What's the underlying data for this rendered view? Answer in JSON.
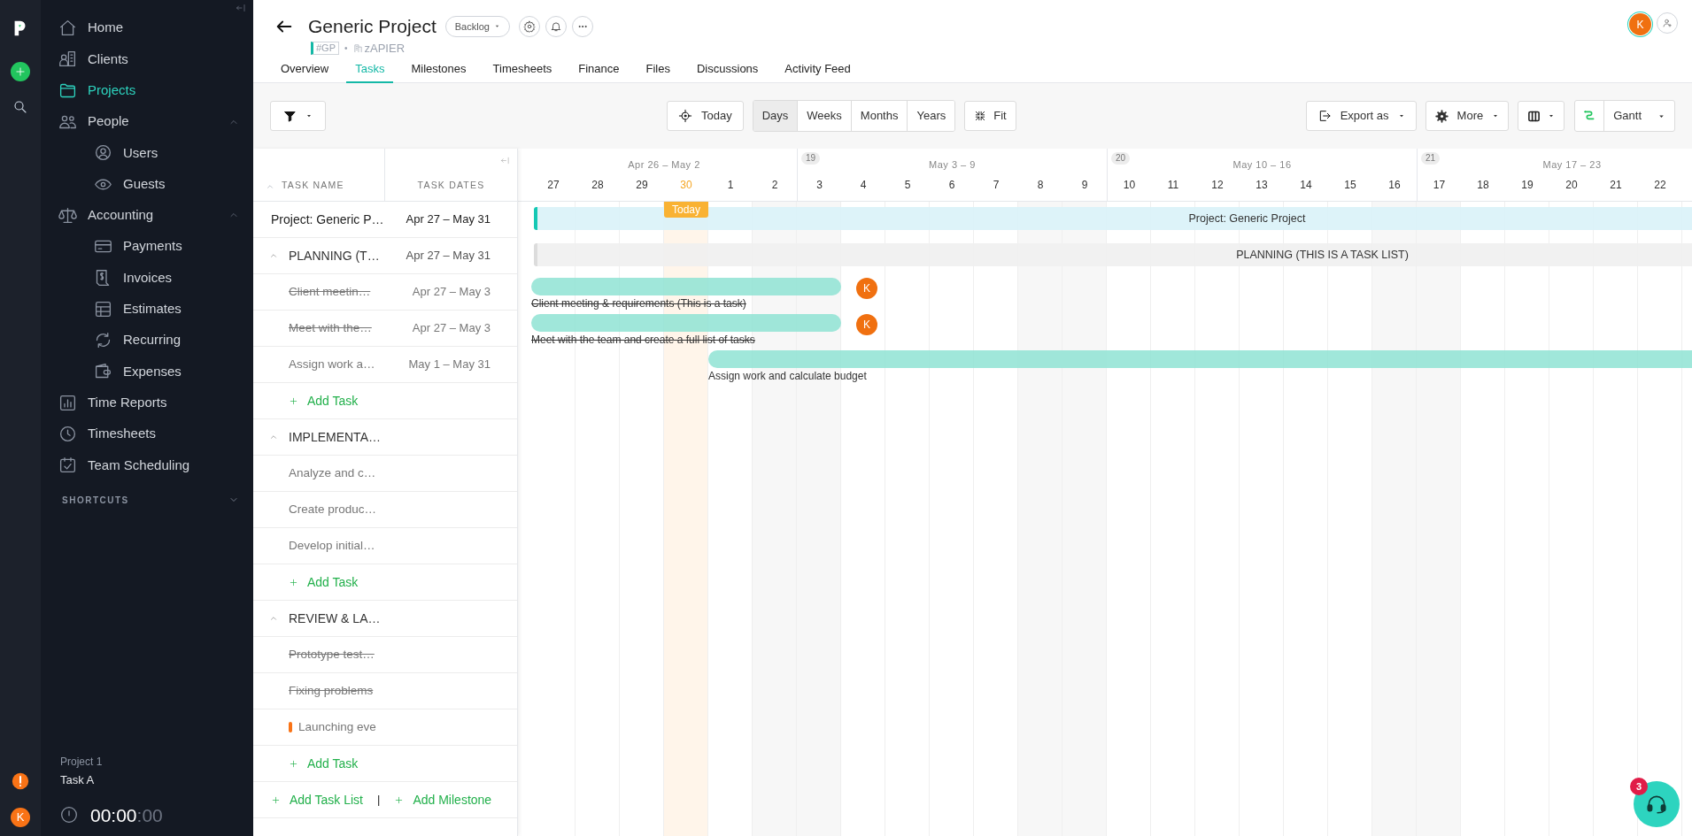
{
  "rail": {
    "avatar": "K"
  },
  "sidebar": {
    "items": [
      {
        "label": "Home",
        "selected": false
      },
      {
        "label": "Clients",
        "selected": false
      },
      {
        "label": "Projects",
        "selected": true
      },
      {
        "label": "People",
        "selected": false,
        "expanded": true,
        "children": [
          {
            "label": "Users",
            "selected": false
          },
          {
            "label": "Guests",
            "selected": false
          }
        ]
      },
      {
        "label": "Accounting",
        "selected": false,
        "expanded": true,
        "children": [
          {
            "label": "Payments",
            "selected": false
          },
          {
            "label": "Invoices",
            "selected": false
          },
          {
            "label": "Estimates",
            "selected": false
          },
          {
            "label": "Recurring",
            "selected": false
          },
          {
            "label": "Expenses",
            "selected": false
          }
        ]
      },
      {
        "label": "Time Reports",
        "selected": false
      },
      {
        "label": "Timesheets",
        "selected": false
      },
      {
        "label": "Team Scheduling",
        "selected": false
      }
    ],
    "shortcuts": {
      "label": "SHORTCUTS",
      "expanded": false
    },
    "timer": {
      "project": "Project 1",
      "task": "Task A",
      "time": "00:00",
      "seconds": ":00"
    }
  },
  "header": {
    "title": "Generic Project",
    "status": "Backlog",
    "code": "#GP",
    "separator": "•",
    "client": "zAPIER",
    "avatar": "K"
  },
  "tabs": [
    {
      "label": "Overview",
      "selected": false
    },
    {
      "label": "Tasks",
      "selected": true
    },
    {
      "label": "Milestones",
      "selected": false
    },
    {
      "label": "Timesheets",
      "selected": false
    },
    {
      "label": "Finance",
      "selected": false
    },
    {
      "label": "Files",
      "selected": false
    },
    {
      "label": "Discussions",
      "selected": false
    },
    {
      "label": "Activity Feed",
      "selected": false
    }
  ],
  "toolbar": {
    "today": "Today",
    "scales": [
      {
        "label": "Days",
        "selected": true
      },
      {
        "label": "Weeks",
        "selected": false
      },
      {
        "label": "Months",
        "selected": false
      },
      {
        "label": "Years",
        "selected": false
      }
    ],
    "fit": "Fit",
    "export": "Export as",
    "more": "More",
    "view": "Gantt"
  },
  "task_list": {
    "columns": [
      "TASK NAME",
      "TASK DATES"
    ],
    "rows": [
      {
        "kind": "project",
        "name": "Project: Generic P…",
        "dates": "Apr 27 – May 31"
      },
      {
        "kind": "list",
        "name": "PLANNING (T…",
        "dates": "Apr 27 – May 31",
        "expanded": true
      },
      {
        "kind": "task",
        "name": "Client meetin…",
        "dates": "Apr 27 – May 3",
        "completed": true
      },
      {
        "kind": "task",
        "name": "Meet with the…",
        "dates": "Apr 27 – May 3",
        "completed": true
      },
      {
        "kind": "task",
        "name": "Assign work a…",
        "dates": "May 1 – May 31",
        "completed": false
      },
      {
        "kind": "add",
        "name": "Add Task"
      },
      {
        "kind": "list",
        "name": "IMPLEMENTA…",
        "expanded": true
      },
      {
        "kind": "task",
        "name": "Analyze and c…",
        "completed": false
      },
      {
        "kind": "task",
        "name": "Create produc…",
        "completed": false
      },
      {
        "kind": "task",
        "name": "Develop initial…",
        "completed": false
      },
      {
        "kind": "add",
        "name": "Add Task"
      },
      {
        "kind": "list",
        "name": "REVIEW & LA…",
        "expanded": true
      },
      {
        "kind": "task",
        "name": "Prototype test…",
        "completed": true
      },
      {
        "kind": "task",
        "name": "Fixing problems",
        "completed": true
      },
      {
        "kind": "task",
        "name": "Launching eve",
        "completed": false,
        "color": "#f97316"
      },
      {
        "kind": "add",
        "name": "Add Task"
      }
    ],
    "footer": {
      "add_list": "Add Task List",
      "separator": "|",
      "add_milestone": "Add Milestone"
    }
  },
  "timeline": {
    "weeks": [
      {
        "label": "Apr 26 – May 2"
      },
      {
        "label": "May 3 – 9",
        "number": "19"
      },
      {
        "label": "May 10 – 16",
        "number": "20"
      },
      {
        "label": "May 17 – 23",
        "number": "21"
      }
    ],
    "days": [
      {
        "label": "27",
        "today": false,
        "shaded": false
      },
      {
        "label": "28",
        "today": false,
        "shaded": false
      },
      {
        "label": "29",
        "today": false,
        "shaded": false
      },
      {
        "label": "30",
        "today": true,
        "shaded": false
      },
      {
        "label": "1",
        "today": false,
        "shaded": false
      },
      {
        "label": "2",
        "today": false,
        "shaded": true
      },
      {
        "label": "3",
        "today": false,
        "shaded": true
      },
      {
        "label": "4",
        "today": false,
        "shaded": false
      },
      {
        "label": "5",
        "today": false,
        "shaded": false
      },
      {
        "label": "6",
        "today": false,
        "shaded": false
      },
      {
        "label": "7",
        "today": false,
        "shaded": false
      },
      {
        "label": "8",
        "today": false,
        "shaded": true
      },
      {
        "label": "9",
        "today": false,
        "shaded": true
      },
      {
        "label": "10",
        "today": false,
        "shaded": false
      },
      {
        "label": "11",
        "today": false,
        "shaded": false
      },
      {
        "label": "12",
        "today": false,
        "shaded": false
      },
      {
        "label": "13",
        "today": false,
        "shaded": false
      },
      {
        "label": "14",
        "today": false,
        "shaded": false
      },
      {
        "label": "15",
        "today": false,
        "shaded": false
      },
      {
        "label": "16",
        "today": false,
        "shaded": true
      },
      {
        "label": "17",
        "today": false,
        "shaded": true
      },
      {
        "label": "18",
        "today": false,
        "shaded": false
      },
      {
        "label": "19",
        "today": false,
        "shaded": false
      },
      {
        "label": "20",
        "today": false,
        "shaded": false
      },
      {
        "label": "21",
        "today": false,
        "shaded": false
      },
      {
        "label": "22",
        "today": false,
        "shaded": false
      }
    ],
    "today_label": "Today",
    "bars": [
      {
        "kind": "project",
        "label": "Project: Generic Project"
      },
      {
        "kind": "list",
        "label": "PLANNING (THIS IS A TASK LIST)"
      },
      {
        "kind": "task",
        "label": "Client meeting & requirements (This is a task)",
        "completed": true,
        "avatar": "K"
      },
      {
        "kind": "task",
        "label": "Meet with the team and create a full list of tasks",
        "completed": true,
        "avatar": "K"
      },
      {
        "kind": "task",
        "label": "Assign work and calculate budget",
        "completed": false
      }
    ]
  },
  "support": {
    "badge": "3"
  }
}
